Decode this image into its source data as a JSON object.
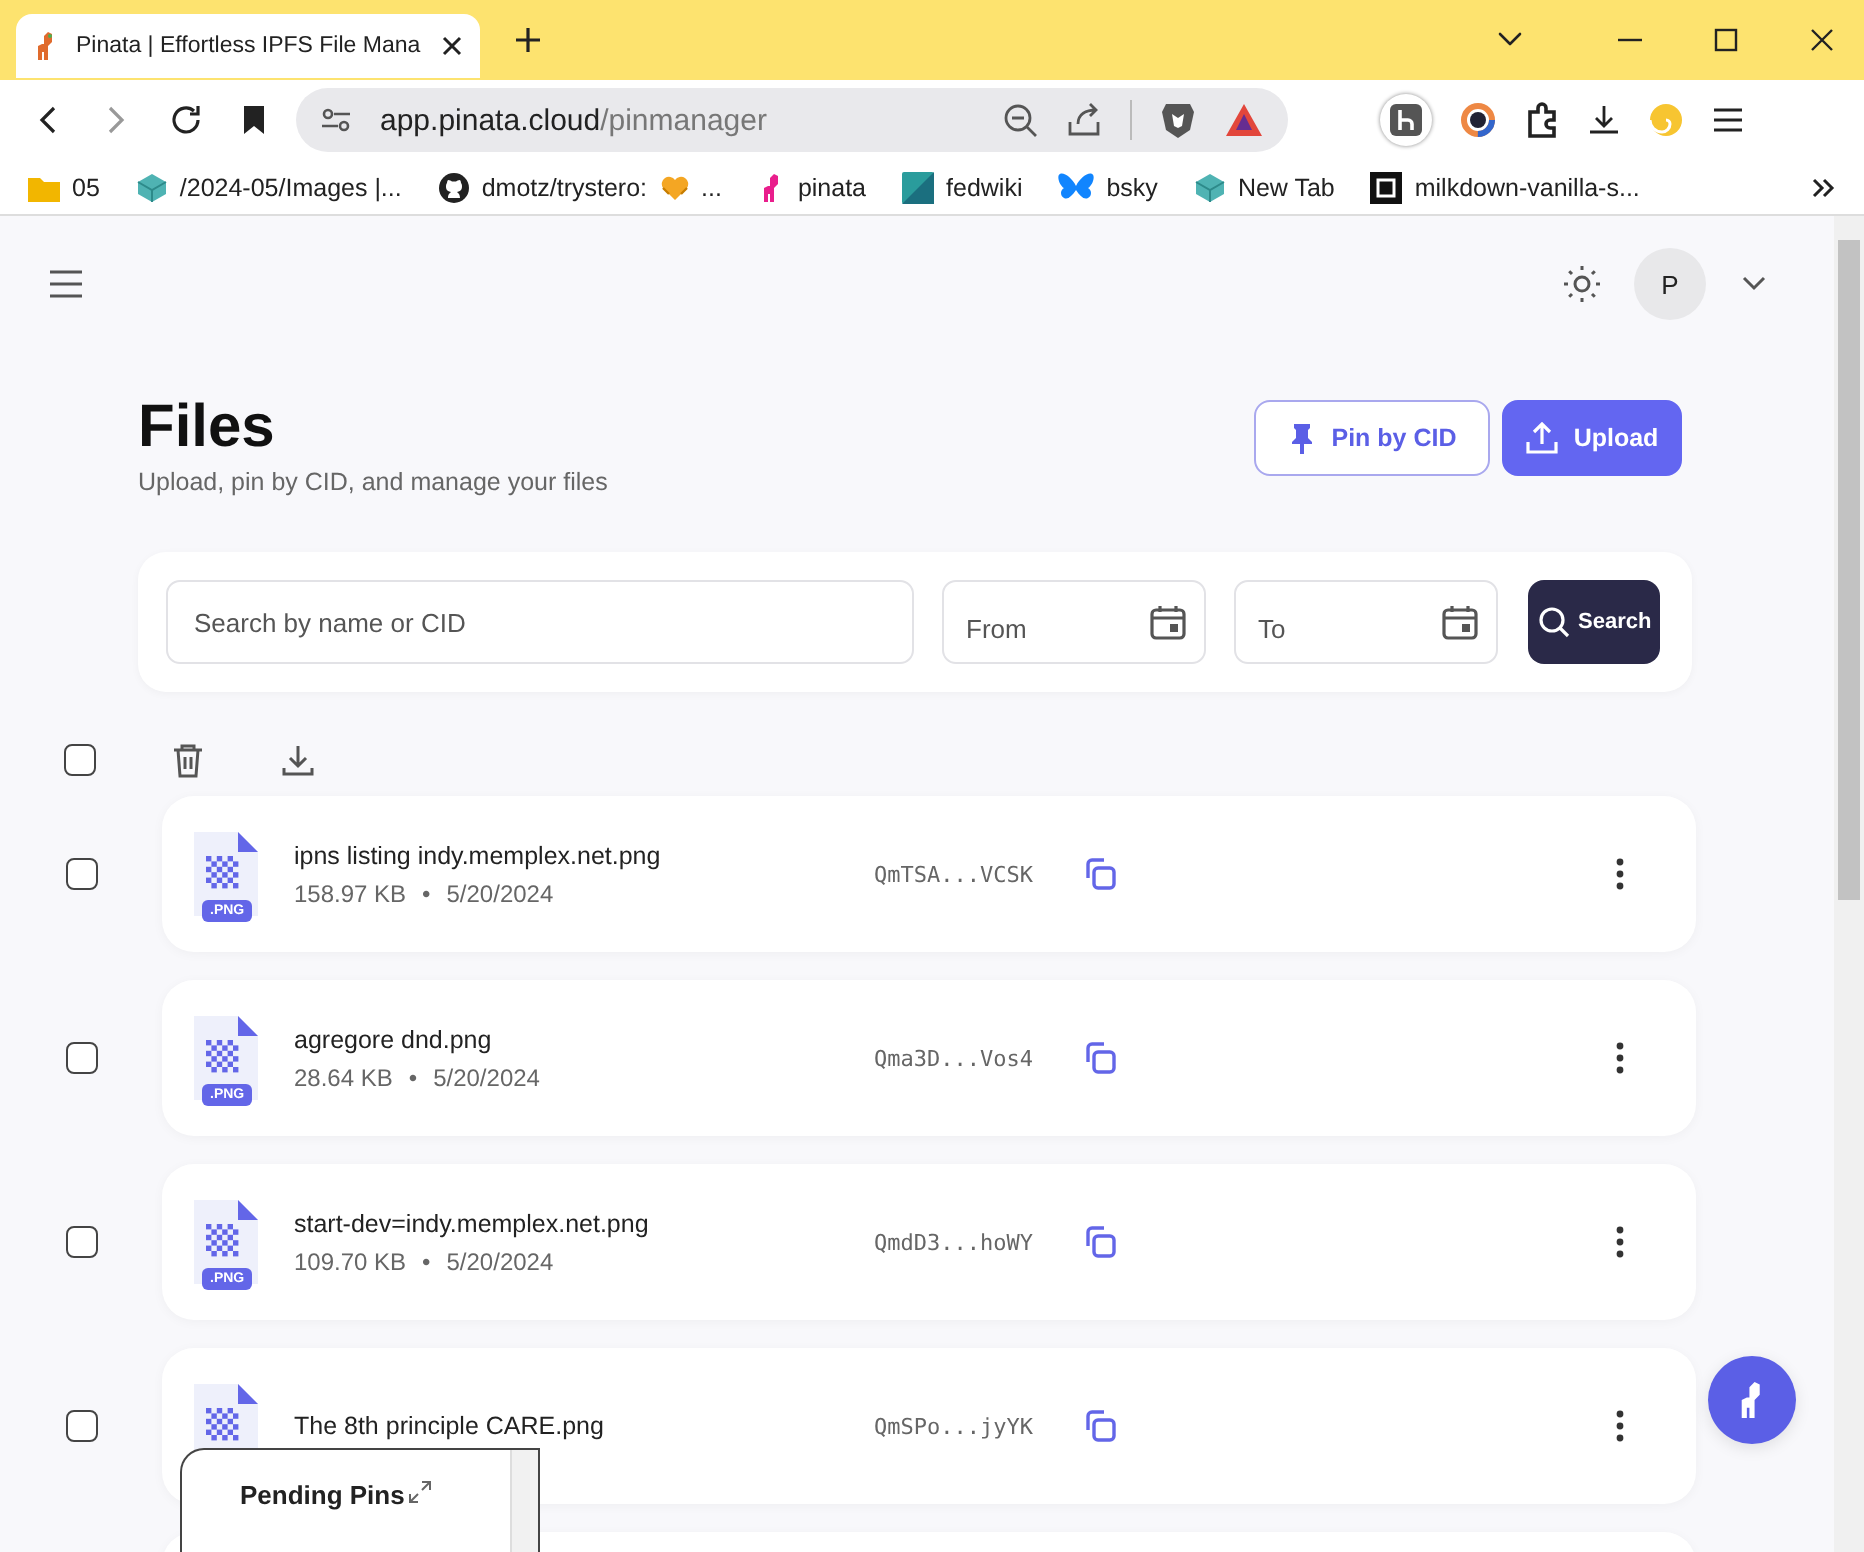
{
  "browser": {
    "tabs": [
      {
        "title": "Pinata | Effortless IPFS File Mana",
        "selected": true
      }
    ],
    "url_host": "app.pinata.cloud",
    "url_path": "/pinmanager",
    "bookmarks": [
      {
        "kind": "folder",
        "label": "05"
      },
      {
        "kind": "cube",
        "label": "/2024-05/Images |..."
      },
      {
        "kind": "github",
        "label": "dmotz/trystero:",
        "suffix": "..."
      },
      {
        "kind": "llama",
        "label": "pinata"
      },
      {
        "kind": "square",
        "label": "fedwiki"
      },
      {
        "kind": "butterfly",
        "label": "bsky"
      },
      {
        "kind": "cube",
        "label": "New Tab"
      },
      {
        "kind": "dark",
        "label": "milkdown-vanilla-s..."
      }
    ]
  },
  "header": {
    "avatar": "P"
  },
  "page": {
    "title": "Files",
    "subtitle": "Upload, pin by CID, and manage your files",
    "buttons": [
      {
        "kind": "outline",
        "label": "Pin by CID"
      },
      {
        "kind": "primary",
        "label": "Upload"
      }
    ]
  },
  "filters": {
    "search_placeholder": "Search by name or CID",
    "from_placeholder": "From",
    "to_placeholder": "To",
    "search_button": "Search"
  },
  "select_all": {
    "checked": false
  },
  "files": [
    {
      "name": "ipns listing indy.memplex.net.png",
      "badge": ".PNG",
      "size": "158.97 KB",
      "dot": "•",
      "date": "5/20/2024",
      "cid": "QmTSA...VCSK",
      "selected": false
    },
    {
      "name": "agregore dnd.png",
      "badge": ".PNG",
      "size": "28.64 KB",
      "dot": "•",
      "date": "5/20/2024",
      "cid": "Qma3D...Vos4",
      "selected": false
    },
    {
      "name": "start-dev=indy.memplex.net.png",
      "badge": ".PNG",
      "size": "109.70 KB",
      "dot": "•",
      "date": "5/20/2024",
      "cid": "QmdD3...hoWY",
      "selected": false
    },
    {
      "name": "The 8th principle CARE.png",
      "cid": "QmSPo...jyYK",
      "selected": false
    }
  ],
  "pending_pins": {
    "title": "Pending Pins"
  }
}
